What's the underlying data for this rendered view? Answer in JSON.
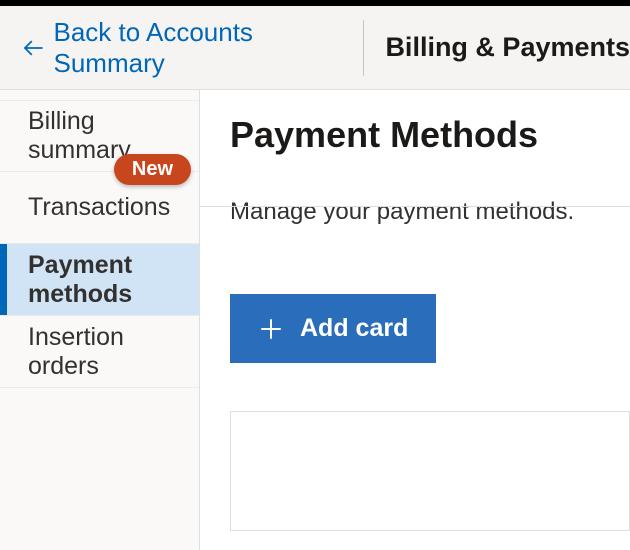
{
  "header": {
    "back_label": "Back to Accounts Summary",
    "title": "Billing & Payments"
  },
  "sidebar": {
    "items": [
      {
        "label": "Billing summary",
        "badge": null
      },
      {
        "label": "Transactions",
        "badge": "New"
      },
      {
        "label": "Payment methods",
        "badge": null
      },
      {
        "label": "Insertion orders",
        "badge": null
      }
    ]
  },
  "main": {
    "title": "Payment Methods",
    "subtext": "Manage your payment methods.",
    "add_button_label": "Add card"
  }
}
